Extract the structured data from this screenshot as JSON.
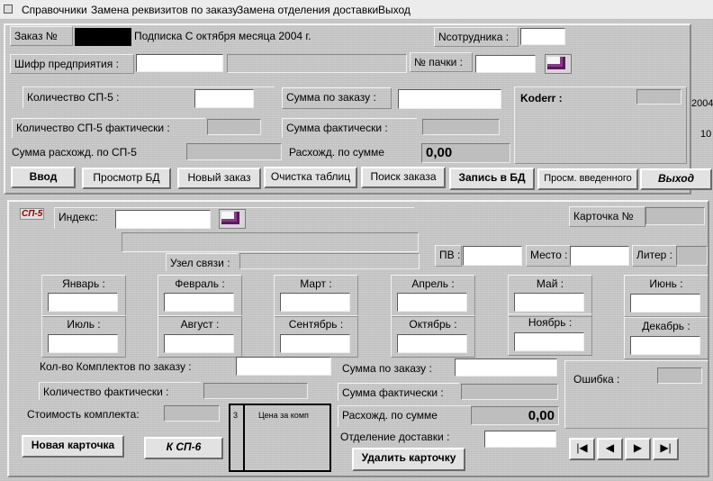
{
  "menu": [
    "Справочники",
    "Замена реквизитов по заказу",
    "Замена отделения доставки",
    "Выход"
  ],
  "order": {
    "order_label": "Заказ №",
    "subscription": "Подписка  С октября месяца  2004 г.",
    "employee_label": "Nсотрудника :",
    "enterprise_label": "Шифр предприятия  :",
    "pack_label": "№ пачки :",
    "sp5_count_label": "Количество СП-5 :",
    "order_sum_label": "Сумма по заказу :",
    "koderr_label": "Koderr :",
    "sp5_actual_label": "Количество СП-5 фактически :",
    "actual_sum_label": "Сумма фактически :",
    "sp5_diff_label": "Сумма расхожд. по СП-5",
    "sum_diff_label": "Расхожд. по сумме",
    "sum_diff_value": "0,00",
    "side_year": "2004",
    "side_num": "10"
  },
  "toolbar": {
    "enter": "Ввод",
    "view_db": "Просмотр БД",
    "new_order": "Новый заказ",
    "clear_tables": "Очистка таблиц",
    "find_order": "Поиск заказа",
    "save_db": "Запись в БД",
    "view_entered": "Просм. введенного",
    "exit": "Выход"
  },
  "card": {
    "tag": "СП-5",
    "index_label": "Индекс:",
    "card_num_label": "Карточка №",
    "hub_label": "Узел связи :",
    "pv_label": "ПВ :",
    "place_label": "Место :",
    "liter_label": "Литер :",
    "months": [
      "Январь :",
      "Февраль :",
      "Март :",
      "Апрель :",
      "Май :",
      "Июнь :",
      "Июль :",
      "Август :",
      "Сентябрь :",
      "Октябрь :",
      "Ноябрь :",
      "Декабрь :"
    ],
    "kits_label": "Кол-во Комплектов по заказу :",
    "kits_actual_label": "Количество фактически :",
    "kit_price_label": "Стоимость комплекта:",
    "card_sum_label": "Сумма по заказу :",
    "card_actual_sum_label": "Сумма фактически :",
    "card_diff_label": "Расхожд. по сумме",
    "card_diff_value": "0,00",
    "delivery_label": "Отделение доставки :",
    "error_label": "Ошибка :",
    "table_col1": "3",
    "table_col2": "Цена за комп",
    "new_card": "Новая карточка",
    "to_sp6": "К СП-6",
    "delete_card": "Удалить карточку"
  },
  "nav": [
    "|◀",
    "◀",
    "▶",
    "▶|"
  ]
}
